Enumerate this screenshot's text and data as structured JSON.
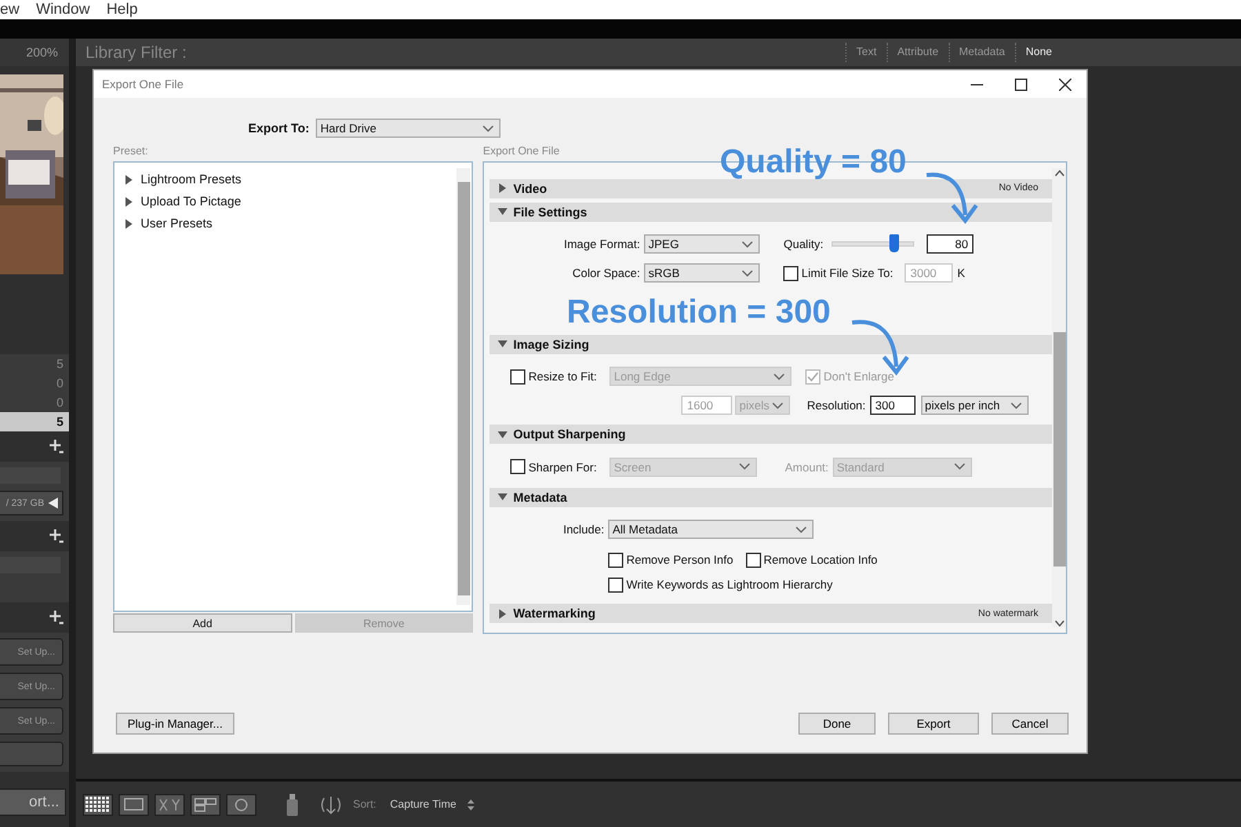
{
  "menu_bar": {
    "items": [
      "ew",
      "Window",
      "Help"
    ]
  },
  "left_panel": {
    "zoom": "200%",
    "counts": [
      {
        "value": "5",
        "selected": false
      },
      {
        "value": "0",
        "selected": false
      },
      {
        "value": "0",
        "selected": false
      },
      {
        "value": "5",
        "selected": true
      }
    ],
    "disk": "/ 237 GB",
    "setup_buttons": [
      "Set Up...",
      "Set Up...",
      "Set Up..."
    ],
    "export_button": "ort..."
  },
  "filter_bar": {
    "title": "Library Filter :",
    "tabs": [
      {
        "label": "Text",
        "selected": false
      },
      {
        "label": "Attribute",
        "selected": false
      },
      {
        "label": "Metadata",
        "selected": false
      },
      {
        "label": "None",
        "selected": true
      }
    ]
  },
  "toolbar": {
    "sort_label": "Sort:",
    "sort_value": "Capture Time"
  },
  "dialog": {
    "title": "Export One File",
    "export_to_label": "Export To:",
    "export_to": "Hard Drive",
    "preset_label": "Preset:",
    "presets": [
      {
        "label": "Lightroom Presets",
        "expanded": false
      },
      {
        "label": "Upload To Pictage",
        "expanded": false
      },
      {
        "label": "User Presets",
        "expanded": false
      }
    ],
    "preset_buttons": [
      {
        "label": "Add",
        "disabled": false
      },
      {
        "label": "Remove",
        "disabled": true
      }
    ],
    "settings_label": "Export One File",
    "sections": [
      {
        "kind": "video",
        "title": "Video",
        "expanded": false,
        "summary": "No Video"
      },
      {
        "kind": "file_settings",
        "title": "File Settings",
        "expanded": true,
        "format_label": "Image Format:",
        "format": "JPEG",
        "quality_label": "Quality:",
        "quality_slider": {
          "level": 0.75
        },
        "quality": "80",
        "color_space_label": "Color Space:",
        "color_space": "sRGB",
        "limit": {
          "label": "Limit File Size To:",
          "checked": false
        },
        "limit_value": "3000",
        "limit_unit": "K"
      },
      {
        "kind": "image_sizing",
        "title": "Image Sizing",
        "expanded": true,
        "resize": {
          "label": "Resize to Fit:",
          "checked": false
        },
        "fit": "Long Edge",
        "enlarge": {
          "label": "Don't Enlarge",
          "checked": true
        },
        "size": "1600",
        "size_unit": "pixels",
        "resolution_label": "Resolution:",
        "resolution": "300",
        "resolution_unit": "pixels per inch"
      },
      {
        "kind": "output_sharpening",
        "title": "Output Sharpening",
        "expanded": true,
        "sharpen": {
          "label": "Sharpen For:",
          "checked": false
        },
        "sharpen_for": "Screen",
        "amount_label": "Amount:",
        "amount": "Standard"
      },
      {
        "kind": "metadata",
        "title": "Metadata",
        "expanded": true,
        "include_label": "Include:",
        "include": "All Metadata",
        "options": [
          {
            "label": "Remove Person Info",
            "checked": false
          },
          {
            "label": "Remove Location Info",
            "checked": false
          },
          {
            "label": "Write Keywords as Lightroom Hierarchy",
            "checked": false
          }
        ]
      },
      {
        "kind": "watermarking",
        "title": "Watermarking",
        "expanded": false,
        "summary": "No watermark"
      }
    ],
    "plugin_button": "Plug-in Manager...",
    "buttons": [
      "Done",
      "Export",
      "Cancel"
    ]
  },
  "annotations": [
    {
      "text": "Quality = 80"
    },
    {
      "text": "Resolution = 300"
    }
  ]
}
